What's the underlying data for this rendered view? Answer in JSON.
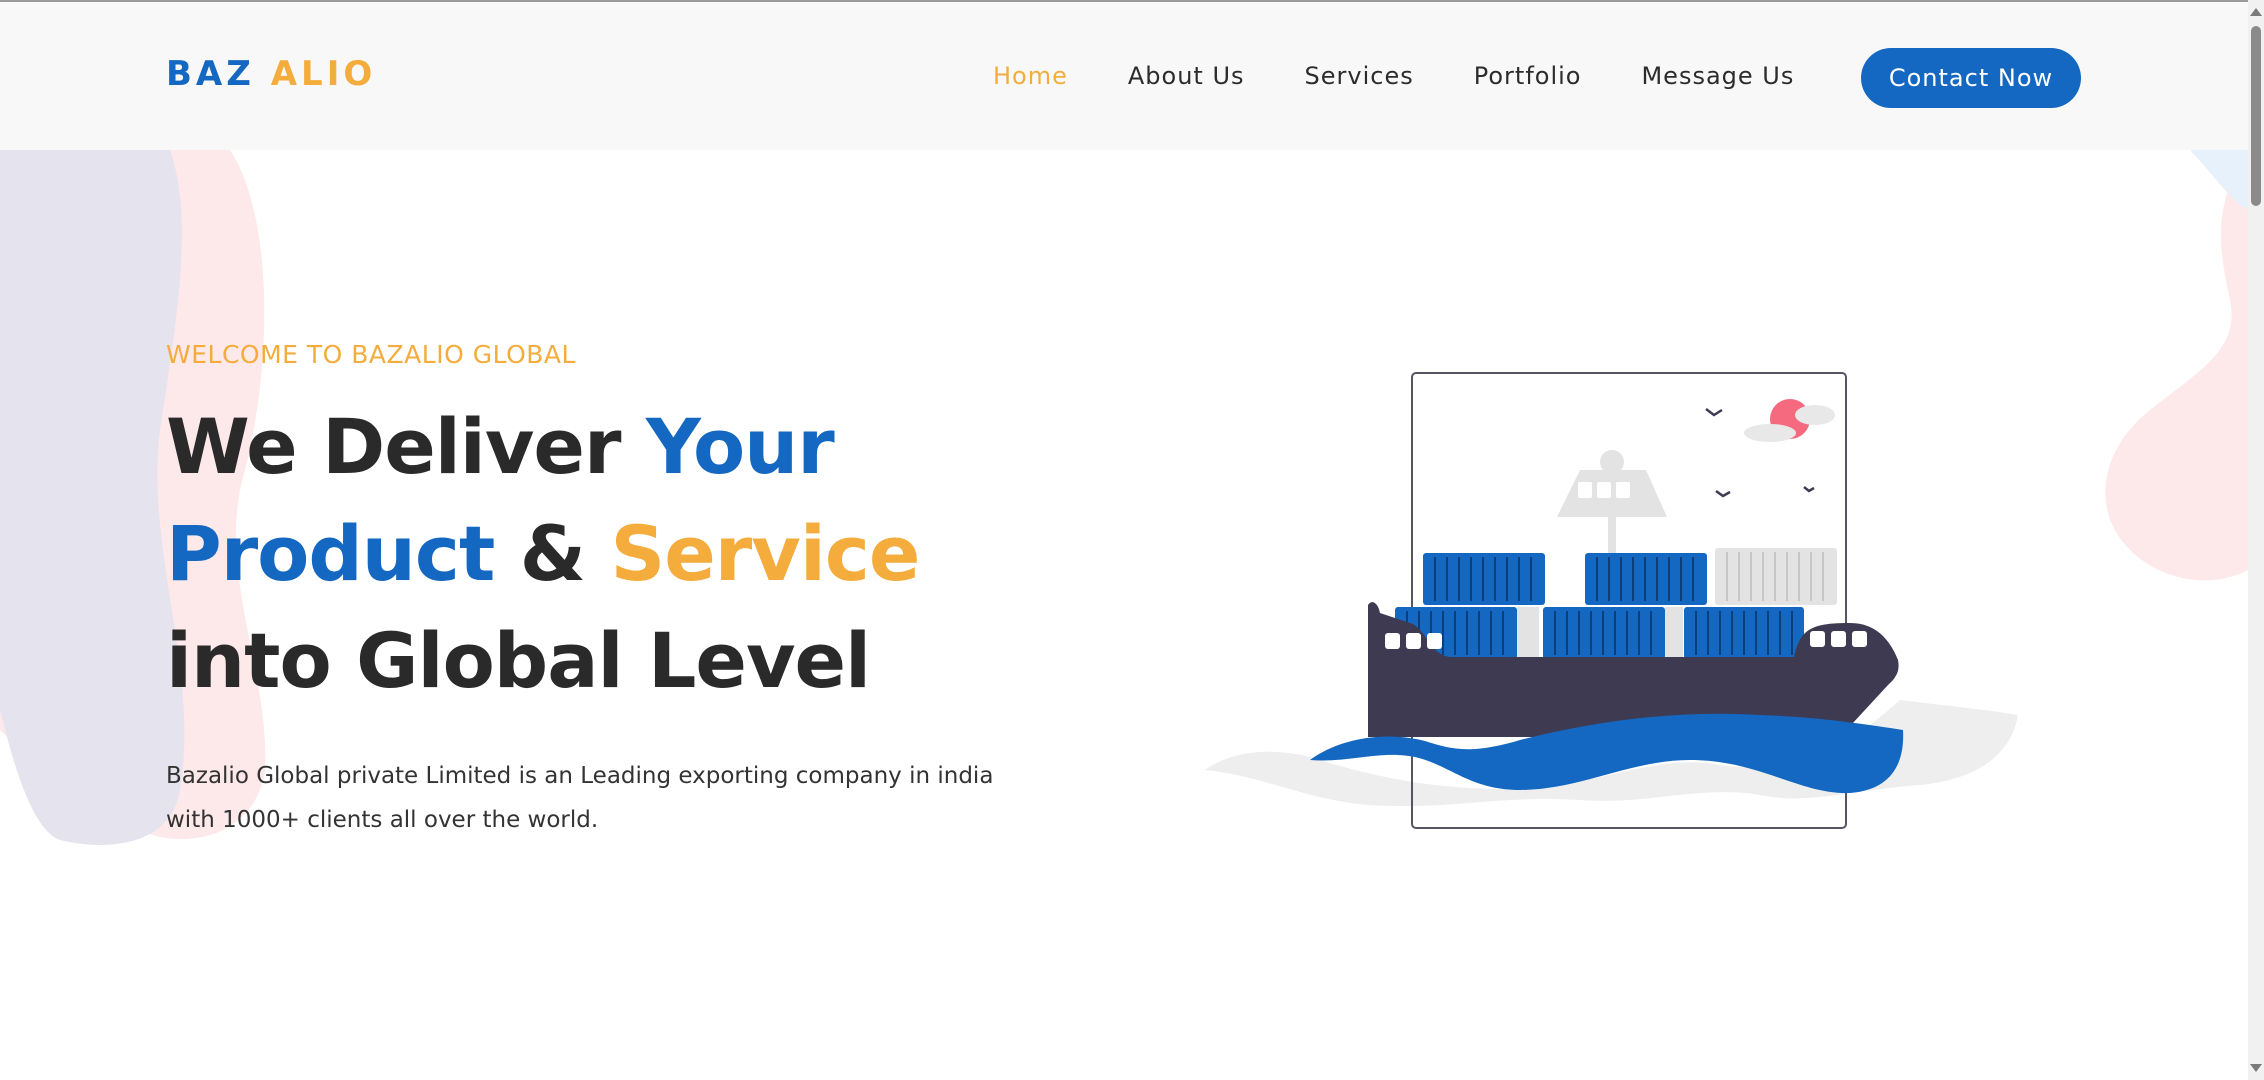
{
  "nav": {
    "logo_part1": "BAZ",
    "logo_part2": "ALIO",
    "links": [
      "Home",
      "About Us",
      "Services",
      "Portfolio",
      "Message Us"
    ],
    "active_link": "Home",
    "cta_label": "Contact Now"
  },
  "hero": {
    "welcome": "WELCOME TO BAZALIO GLOBAL",
    "line1_a": "We Deliver",
    "line1_b": "Your",
    "line2_a": "Product",
    "line2_b": "&",
    "line2_c": "Service",
    "line3": "into Global Level",
    "description": "Bazalio Global private Limited is an Leading exporting company in india with 1000+ clients all over the world."
  },
  "illustration": {
    "icon": "cargo-ship-illustration",
    "colors": {
      "hull": "#3e3a52",
      "container_blue": "#1468c2",
      "wave_blue": "#1468c2",
      "sun": "#f56a7e",
      "container_grey": "#e3e3e3"
    }
  },
  "colors": {
    "brand_blue": "#1468c2",
    "brand_orange": "#f4ad3d",
    "text_dark": "#2a2a2a",
    "nav_bg": "#f8f8f8"
  }
}
